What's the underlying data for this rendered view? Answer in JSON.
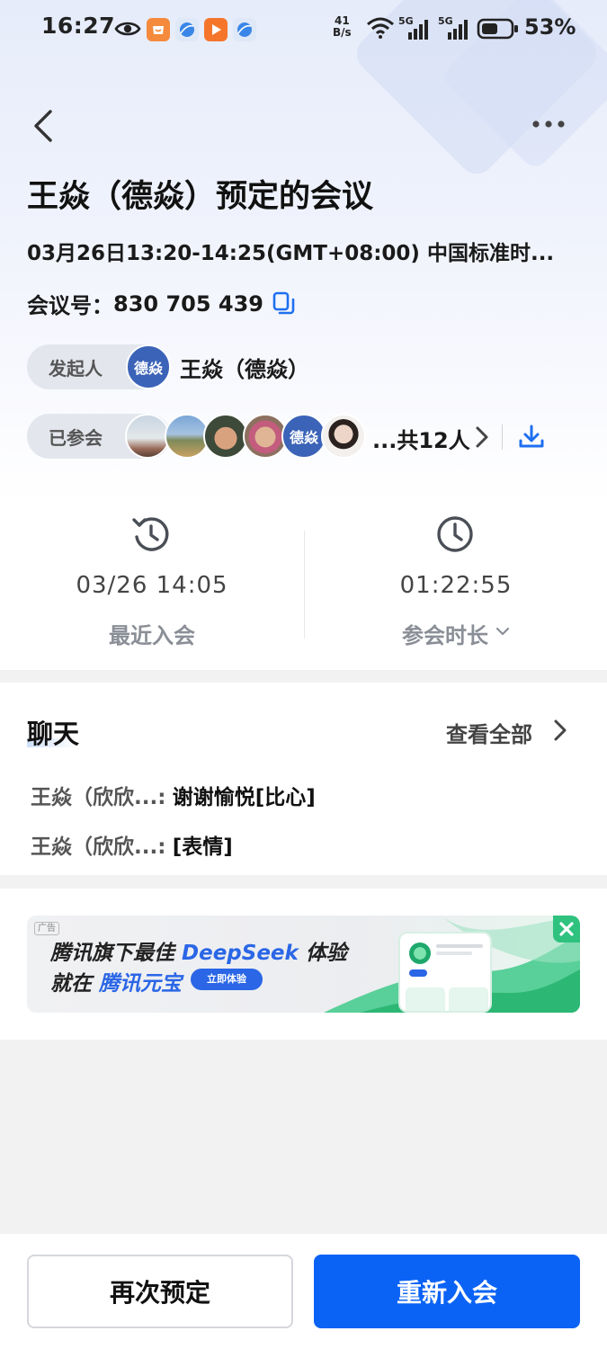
{
  "status_bar": {
    "time": "16:27",
    "net_speed_top": "41",
    "net_speed_bottom": "B/s",
    "signal1": "5G",
    "signal2": "5G",
    "battery": "53%"
  },
  "meeting": {
    "title": "王焱（德焱）预定的会议",
    "time_range": "03月26日13:20-14:25(GMT+08:00) 中国标准时...",
    "meeting_id_label": "会议号：",
    "meeting_id": "830 705 439",
    "initiator_label": "发起人",
    "initiator_avatar_text": "德焱",
    "initiator_name": "王焱（德焱）",
    "attended_label": "已参会",
    "attendee_avatar_text": "德焱",
    "attendees_total": "...共12人"
  },
  "stats": {
    "last_join_value": "03/26 14:05",
    "last_join_label": "最近入会",
    "duration_value": "01:22:55",
    "duration_label": "参会时长"
  },
  "chat": {
    "title": "聊天",
    "view_all": "查看全部",
    "messages": [
      {
        "sender": "王焱（欣欣...:",
        "text": "谢谢愉悦[比心]"
      },
      {
        "sender": "王焱（欣欣...:",
        "text": "[表情]"
      }
    ]
  },
  "ad": {
    "tag": "广告",
    "line1_prefix": "腾讯旗下最佳 ",
    "line1_brand": "DeepSeek",
    "line1_suffix": " 体验",
    "line2_prefix": "就在 ",
    "line2_brand": "腾讯元宝",
    "cta": "立即体验"
  },
  "actions": {
    "rebook": "再次预定",
    "rejoin": "重新入会"
  },
  "colors": {
    "primary": "#0b63f6",
    "avatar_blue": "#3b63b8",
    "ad_green": "#2ec27e"
  }
}
